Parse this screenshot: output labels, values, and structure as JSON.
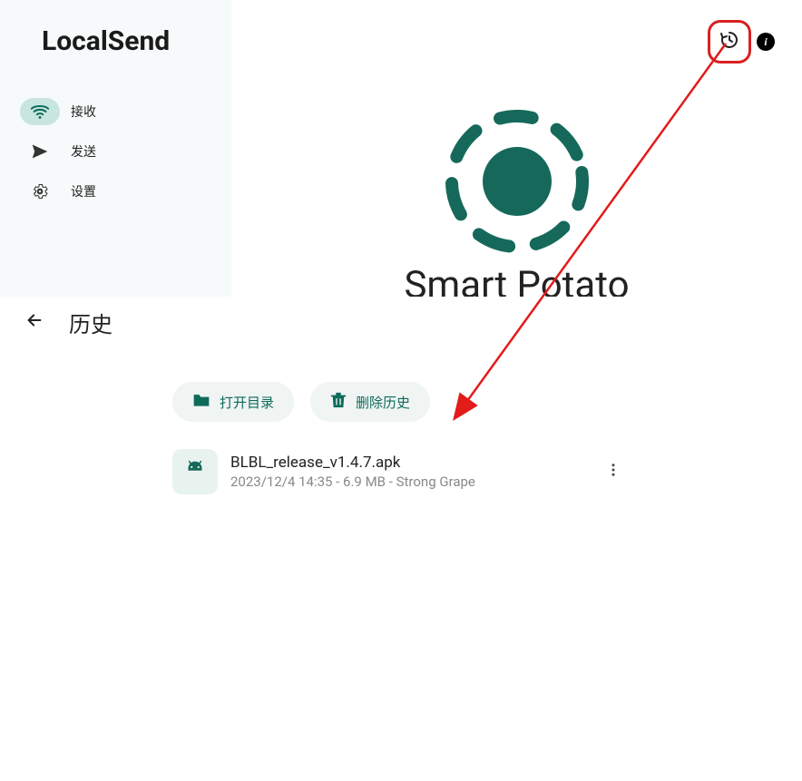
{
  "app": {
    "title": "LocalSend"
  },
  "sidebar": {
    "items": [
      {
        "label": "接收",
        "icon": "wifi",
        "active": true
      },
      {
        "label": "发送",
        "icon": "send",
        "active": false
      },
      {
        "label": "设置",
        "icon": "gear",
        "active": false
      }
    ]
  },
  "main": {
    "device_name": "Smart Potato"
  },
  "history": {
    "title": "历史",
    "open_folder_label": "打开目录",
    "delete_history_label": "删除历史",
    "items": [
      {
        "name": "BLBL_release_v1.4.7.apk",
        "timestamp": "2023/12/4 14:35",
        "size": "6.9 MB",
        "sender": "Strong Grape",
        "meta": "2023/12/4 14:35 - 6.9 MB - Strong Grape"
      }
    ]
  },
  "colors": {
    "accent": "#0d6b5a",
    "sidebar_bg": "#f7fafa",
    "active_pill": "#c8e6df",
    "annotation": "#d92020"
  }
}
